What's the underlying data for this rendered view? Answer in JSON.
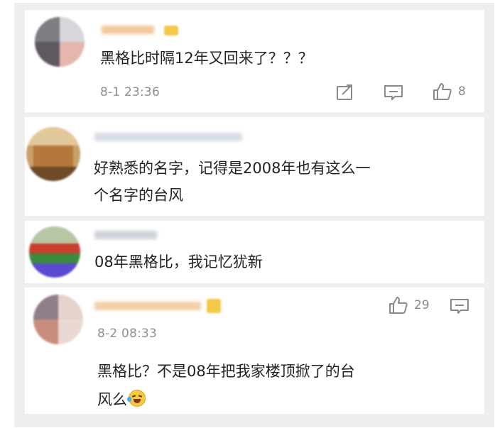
{
  "comments": [
    {
      "text": "黑格比时隔12年又回来了？？？",
      "time": "8-1 23:36",
      "likes": "8",
      "icons": [
        "share-icon",
        "reply-icon",
        "thumbs-up-icon"
      ]
    },
    {
      "text_line1": "好熟悉的名字，记得是2008年也有这么一",
      "text_line2": "个名字的台风"
    },
    {
      "text": "08年黑格比，我记忆犹新"
    },
    {
      "text_line1": "黑格比？不是08年把我家楼顶掀了的台",
      "text_line2": "风么",
      "time": "8-2 08:33",
      "likes": "29",
      "emoji": "laugh-cry-emoji",
      "icons": [
        "thumbs-up-icon",
        "reply-icon"
      ]
    }
  ],
  "colors": {
    "text": "#222222",
    "meta": "#8f8f8f",
    "icon": "#8a8a8a",
    "background": "#eeeeee",
    "badge": "#f3c94a"
  }
}
